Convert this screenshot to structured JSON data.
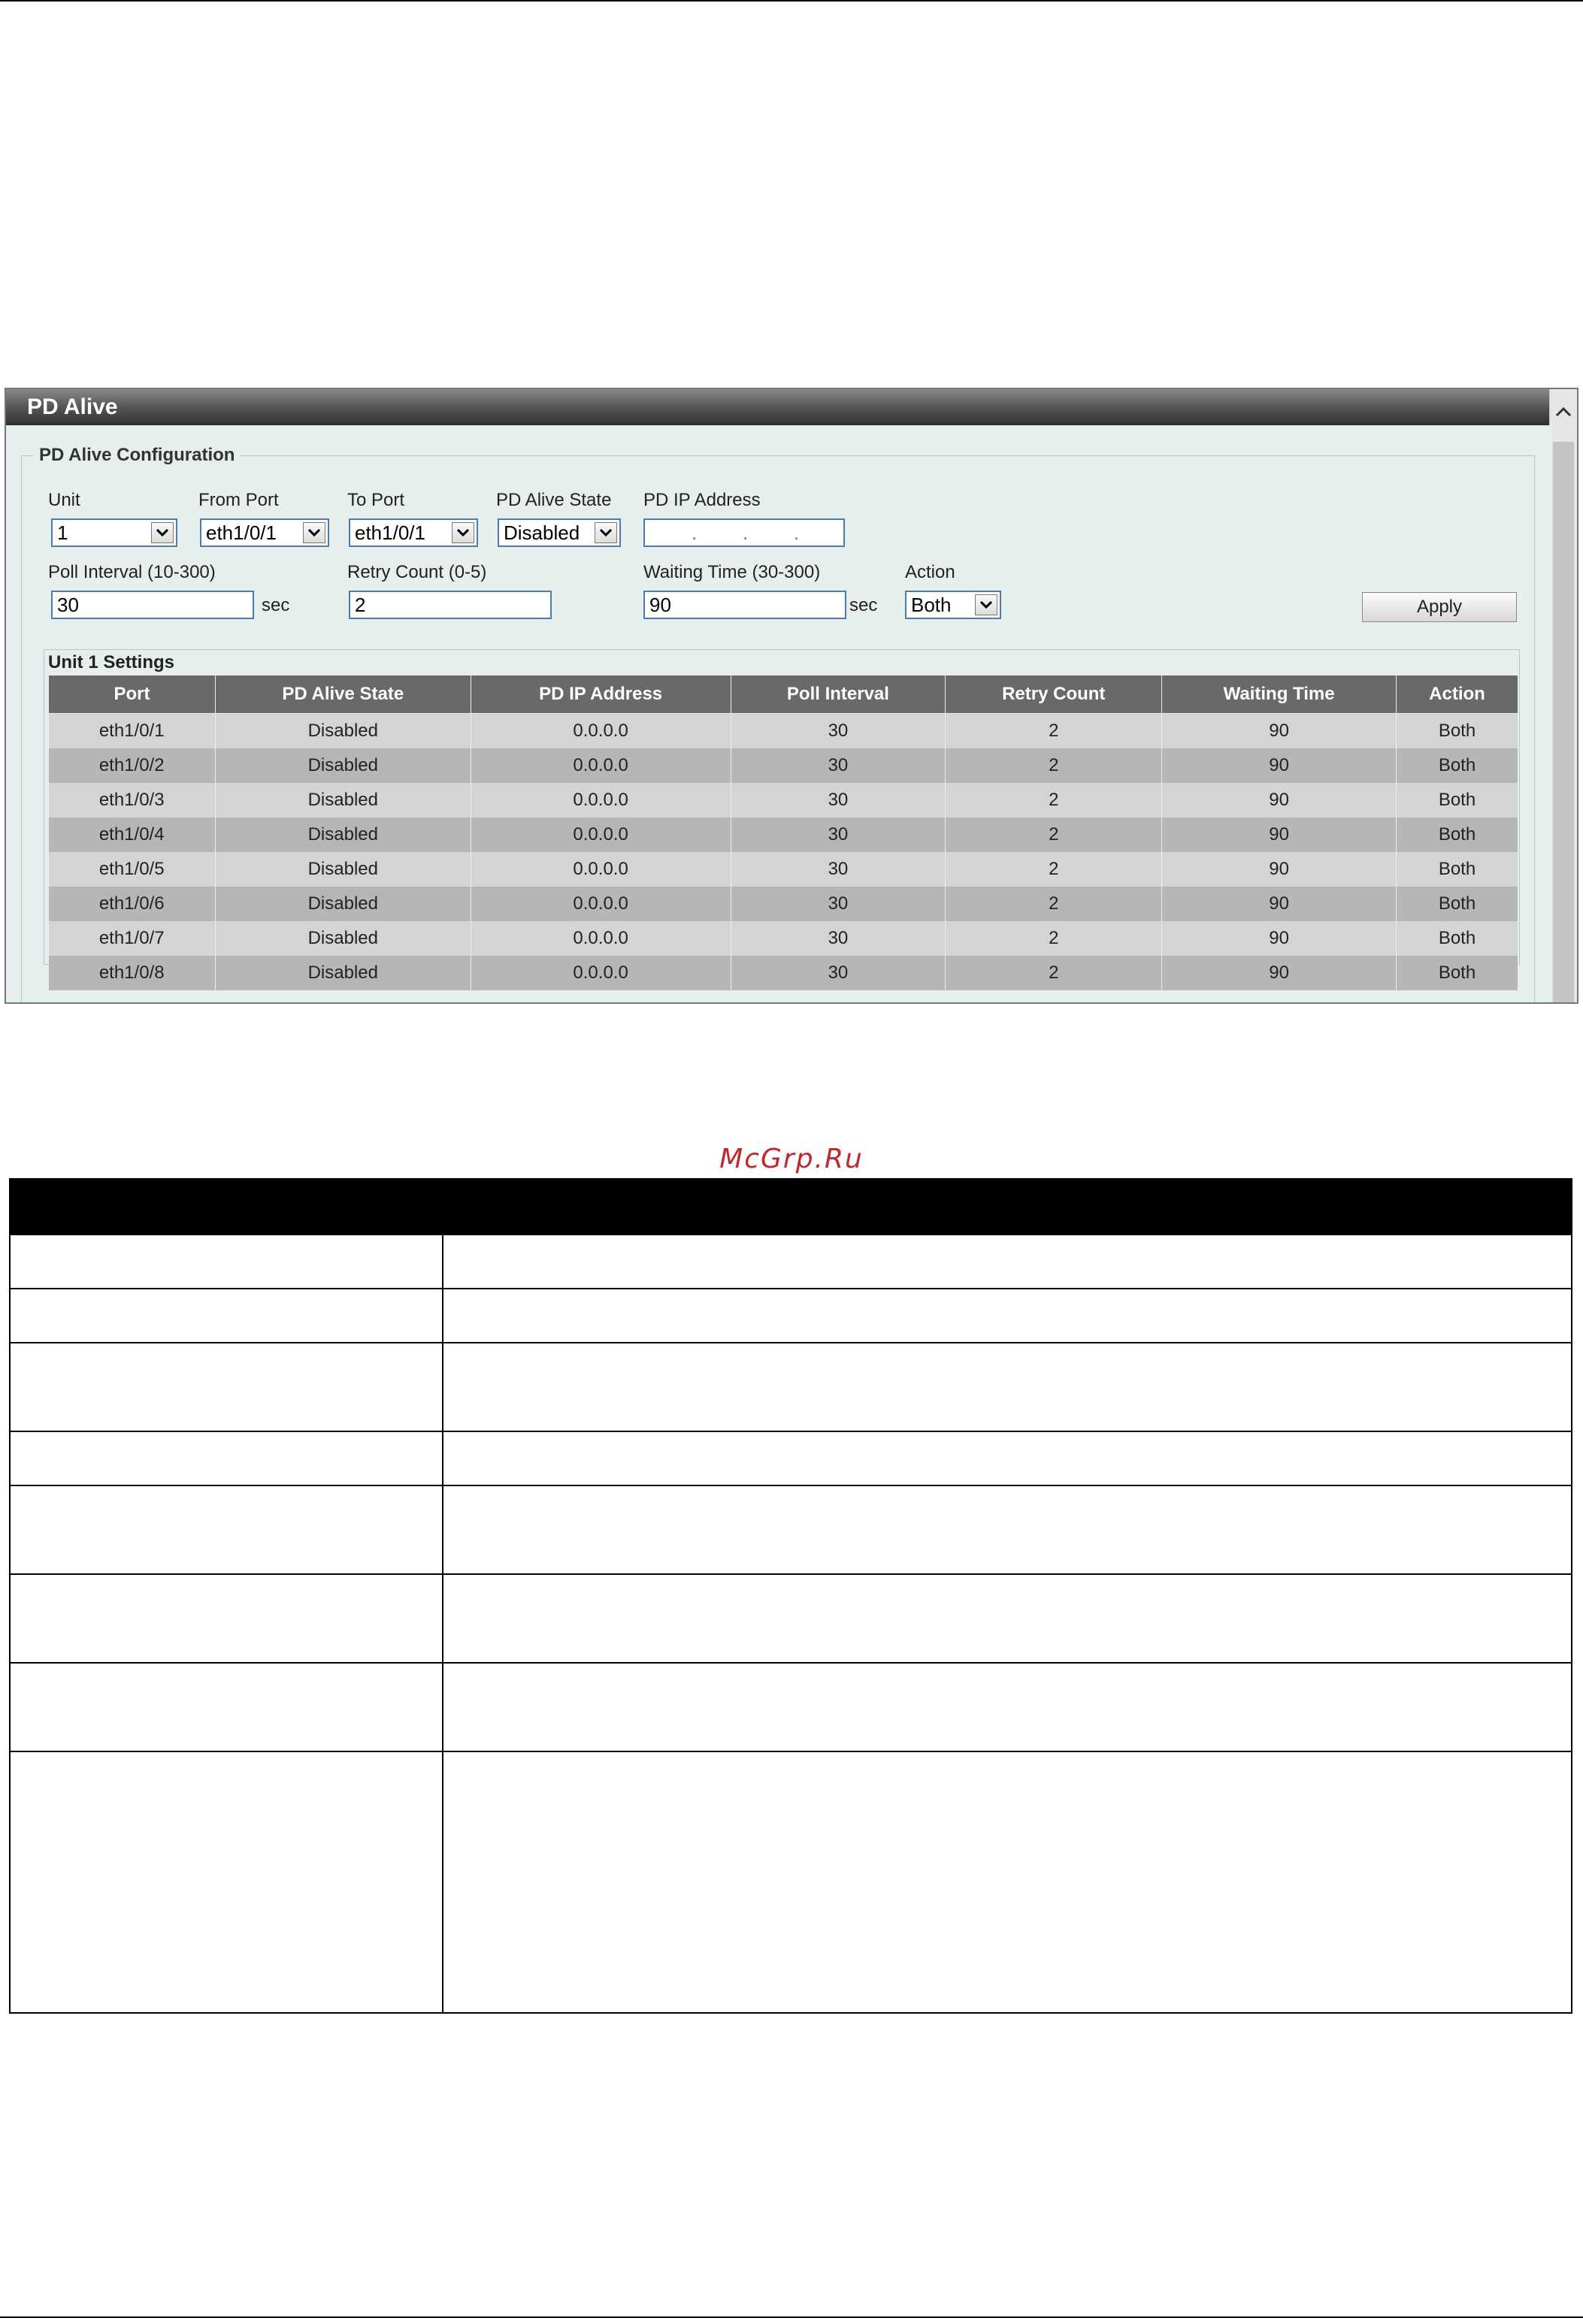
{
  "window": {
    "title": "PD Alive"
  },
  "config": {
    "legend": "PD Alive Configuration",
    "unit": {
      "label": "Unit",
      "value": "1"
    },
    "from_port": {
      "label": "From Port",
      "value": "eth1/0/1"
    },
    "to_port": {
      "label": "To Port",
      "value": "eth1/0/1"
    },
    "pd_alive_state": {
      "label": "PD Alive State",
      "value": "Disabled"
    },
    "pd_ip_address": {
      "label": "PD IP Address",
      "value": ""
    },
    "poll_interval": {
      "label": "Poll Interval (10-300)",
      "value": "30",
      "unit": "sec"
    },
    "retry_count": {
      "label": "Retry Count (0-5)",
      "value": "2"
    },
    "waiting_time": {
      "label": "Waiting Time (30-300)",
      "value": "90",
      "unit": "sec"
    },
    "action": {
      "label": "Action",
      "value": "Both"
    },
    "apply_label": "Apply"
  },
  "settings": {
    "title": "Unit 1 Settings",
    "columns": [
      "Port",
      "PD Alive State",
      "PD IP Address",
      "Poll Interval",
      "Retry Count",
      "Waiting Time",
      "Action"
    ],
    "rows": [
      [
        "eth1/0/1",
        "Disabled",
        "0.0.0.0",
        "30",
        "2",
        "90",
        "Both"
      ],
      [
        "eth1/0/2",
        "Disabled",
        "0.0.0.0",
        "30",
        "2",
        "90",
        "Both"
      ],
      [
        "eth1/0/3",
        "Disabled",
        "0.0.0.0",
        "30",
        "2",
        "90",
        "Both"
      ],
      [
        "eth1/0/4",
        "Disabled",
        "0.0.0.0",
        "30",
        "2",
        "90",
        "Both"
      ],
      [
        "eth1/0/5",
        "Disabled",
        "0.0.0.0",
        "30",
        "2",
        "90",
        "Both"
      ],
      [
        "eth1/0/6",
        "Disabled",
        "0.0.0.0",
        "30",
        "2",
        "90",
        "Both"
      ],
      [
        "eth1/0/7",
        "Disabled",
        "0.0.0.0",
        "30",
        "2",
        "90",
        "Both"
      ],
      [
        "eth1/0/8",
        "Disabled",
        "0.0.0.0",
        "30",
        "2",
        "90",
        "Both"
      ]
    ]
  },
  "watermark": "McGrp.Ru",
  "icons": {
    "select_arrow": "chevron-down-icon",
    "scroll_up": "chevron-up-icon"
  },
  "colors": {
    "title_bar": "#3a3a3a",
    "content_bg": "#e6eeee",
    "table_header": "#696969",
    "row_light": "#d4d4d4",
    "row_dark": "#b6b6b6",
    "field_border": "#4b7bb0",
    "watermark": "#c0282f"
  }
}
